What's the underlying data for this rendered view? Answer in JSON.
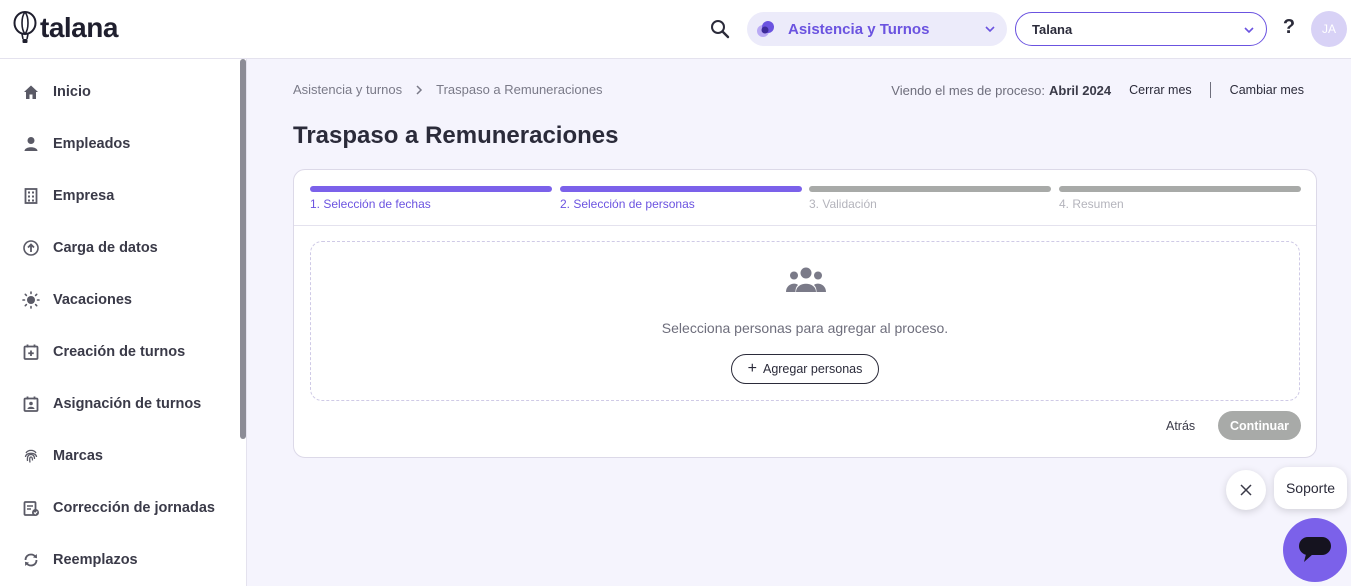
{
  "app": {
    "logo_text": "talana"
  },
  "topbar": {
    "module": "Asistencia y Turnos",
    "company": "Talana",
    "help": "?",
    "avatar_initials": "JA"
  },
  "sidebar": {
    "items": [
      {
        "label": "Inicio",
        "icon": "home-icon"
      },
      {
        "label": "Empleados",
        "icon": "person-icon"
      },
      {
        "label": "Empresa",
        "icon": "building-icon"
      },
      {
        "label": "Carga de datos",
        "icon": "upload-icon"
      },
      {
        "label": "Vacaciones",
        "icon": "sun-icon"
      },
      {
        "label": "Creación de turnos",
        "icon": "calendar-add-icon"
      },
      {
        "label": "Asignación de turnos",
        "icon": "calendar-person-icon"
      },
      {
        "label": "Marcas",
        "icon": "fingerprint-icon"
      },
      {
        "label": "Corrección de jornadas",
        "icon": "calendar-edit-icon"
      },
      {
        "label": "Reemplazos",
        "icon": "swap-icon"
      }
    ]
  },
  "breadcrumb": {
    "parent": "Asistencia y turnos",
    "current": "Traspaso a Remuneraciones"
  },
  "period": {
    "prefix": "Viendo el mes de proceso:",
    "value": "Abril 2024",
    "close_label": "Cerrar mes",
    "change_label": "Cambiar mes"
  },
  "page": {
    "title": "Traspaso a Remuneraciones"
  },
  "steps": [
    {
      "label": "1. Selección de fechas",
      "state": "done"
    },
    {
      "label": "2. Selección de personas",
      "state": "done"
    },
    {
      "label": "3. Validación",
      "state": "pending"
    },
    {
      "label": "4. Resumen",
      "state": "pending"
    }
  ],
  "empty_state": {
    "message": "Selecciona personas para agregar al proceso.",
    "add_label": "Agregar personas"
  },
  "actions": {
    "back_label": "Atrás",
    "continue_label": "Continuar"
  },
  "support": {
    "label": "Soporte"
  },
  "colors": {
    "accent": "#7b61ea",
    "accent_text": "#6b53e0",
    "pending": "#a8aaa8",
    "background": "#f5f4fd"
  }
}
